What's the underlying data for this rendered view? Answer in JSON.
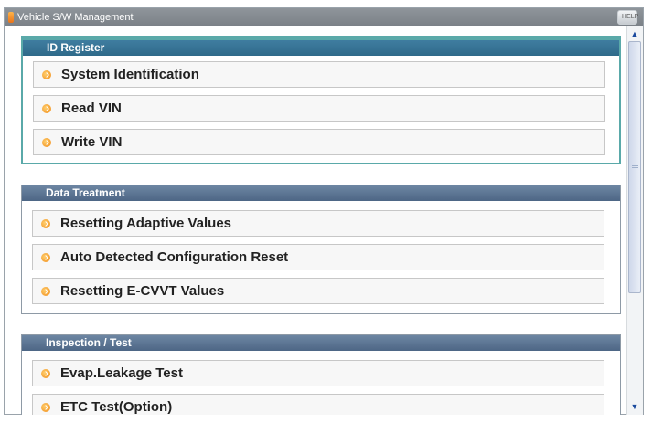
{
  "window": {
    "title": "Vehicle S/W Management",
    "help_label": "HELP"
  },
  "sections": [
    {
      "header": "ID Register",
      "items": [
        "System Identification",
        "Read VIN",
        "Write VIN"
      ]
    },
    {
      "header": "Data Treatment",
      "items": [
        "Resetting Adaptive Values",
        "Auto Detected Configuration Reset",
        "Resetting E-CVVT Values"
      ]
    },
    {
      "header": "Inspection / Test",
      "items": [
        "Evap.Leakage Test",
        "ETC Test(Option)"
      ]
    }
  ],
  "colors": {
    "active_border": "#5aa9a9",
    "header": "#4d6685",
    "bullet": "#f08a16"
  }
}
